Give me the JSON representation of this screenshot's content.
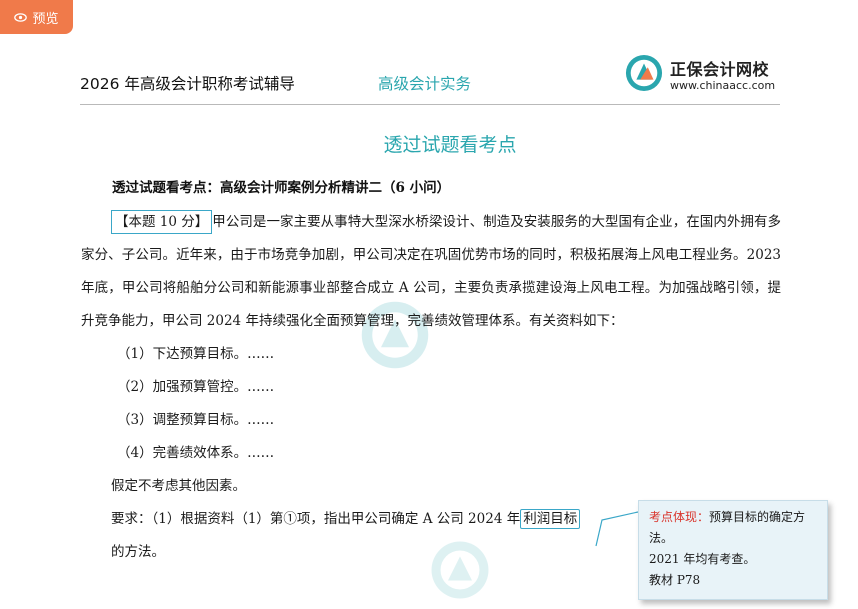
{
  "preview": {
    "label": "预览",
    "icon": "eye-icon"
  },
  "header": {
    "exam_title": "2026 年高级会计职称考试辅导",
    "subject": "高级会计实务",
    "brand_name": "正保会计网校",
    "brand_url": "www.chinaacc.com"
  },
  "section_title": "透过试题看考点",
  "case_title": "透过试题看考点：高级会计师案例分析精讲二（6 小问）",
  "score_tag": "【本题 10 分】",
  "paragraph1": "甲公司是一家主要从事特大型深水桥梁设计、制造及安装服务的大型国有企业，在国内外拥有多家分、子公司。近年来，由于市场竞争加剧，甲公司决定在巩固优势市场的同时，积极拓展海上风电工程业务。2023 年底，甲公司将船舶分公司和新能源事业部整合成立 A 公司，主要负责承揽建设海上风电工程。为加强战略引领，提升竞争能力，甲公司 2024 年持续强化全面预算管理，完善绩效管理体系。有关资料如下：",
  "items": [
    "（1）下达预算目标。……",
    "（2）加强预算管控。……",
    "（3）调整预算目标。……",
    "（4）完善绩效体系。……"
  ],
  "note": "假定不考虑其他因素。",
  "requirement": {
    "prefix": "要求：（1）根据资料（1）第①项，指出甲公司确定 A 公司 2024 年",
    "highlight": "利润目标",
    "suffix": "的方法。"
  },
  "callout": {
    "label": "考点体现：",
    "line1": "预算目标的确定方法。",
    "line2": "2021 年均有考查。",
    "line3": "教材 P78"
  },
  "colors": {
    "accent": "#2aa6ae",
    "preview_bg": "#f07a4a",
    "callout_label": "#d9342b",
    "box_border": "#3aa7c8"
  }
}
